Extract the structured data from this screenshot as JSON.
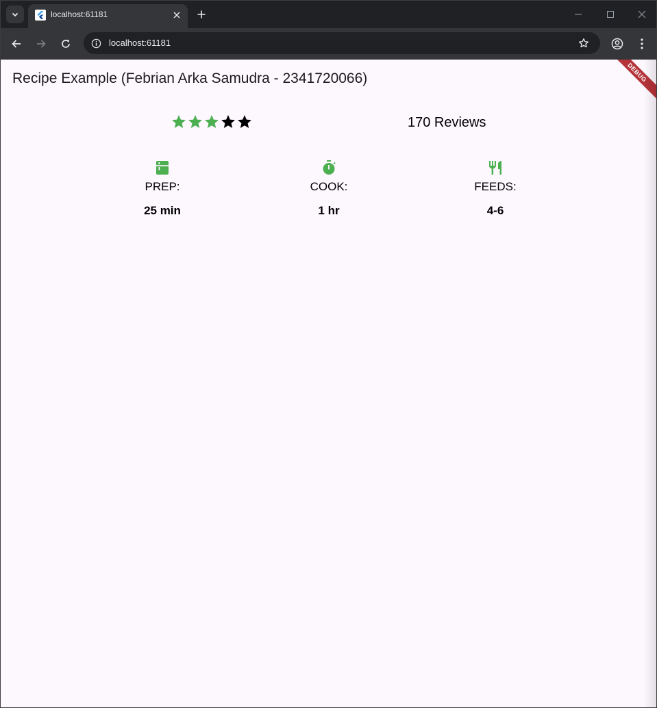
{
  "browser": {
    "tab_title": "localhost:61181",
    "url": "localhost:61181"
  },
  "app": {
    "title": "Recipe Example (Febrian Arka Samudra - 2341720066)",
    "debug_banner": "DEBUG",
    "rating": {
      "stars_filled": 3,
      "stars_total": 5,
      "filled_color": "#4caf50",
      "empty_color": "#000000",
      "reviews_text": "170 Reviews"
    },
    "info": [
      {
        "icon": "kitchen-icon",
        "label": "PREP:",
        "value": "25 min"
      },
      {
        "icon": "timer-icon",
        "label": "COOK:",
        "value": "1 hr"
      },
      {
        "icon": "restaurant-icon",
        "label": "FEEDS:",
        "value": "4-6"
      }
    ],
    "icon_color": "#4caf50"
  }
}
